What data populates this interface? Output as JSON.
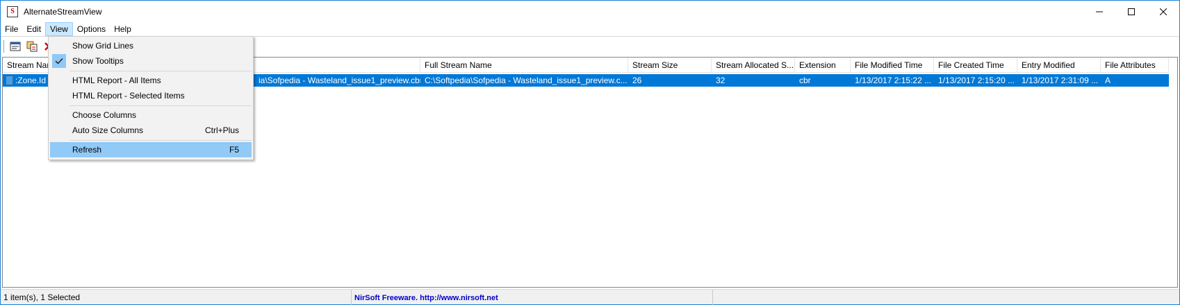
{
  "window": {
    "title": "AlternateStreamView",
    "app_icon_glyph": "S"
  },
  "menubar": {
    "items": [
      "File",
      "Edit",
      "View",
      "Options",
      "Help"
    ],
    "active": "View"
  },
  "list": {
    "columns": [
      "Stream Name",
      "",
      "Full Stream Name",
      "Stream Size",
      "Stream Allocated S...",
      "Extension",
      "File Modified Time",
      "File Created Time",
      "Entry Modified",
      "File Attributes"
    ],
    "rows": [
      {
        "cells": [
          ":Zone.Id",
          "ia\\Sofpedia - Wasteland_issue1_preview.cbr",
          "C:\\Softpedia\\Sofpedia - Wasteland_issue1_preview.c...",
          "26",
          "32",
          "cbr",
          "1/13/2017 2:15:22 ...",
          "1/13/2017 2:15:20 ...",
          "1/13/2017 2:31:09 ...",
          "A"
        ],
        "selected": true
      }
    ]
  },
  "view_menu": {
    "items": [
      {
        "label": "Show Grid Lines",
        "shortcut": "",
        "checked": false
      },
      {
        "label": "Show Tooltips",
        "shortcut": "",
        "checked": true
      },
      {
        "label": "HTML Report - All Items",
        "shortcut": "",
        "checked": false
      },
      {
        "label": "HTML Report - Selected Items",
        "shortcut": "",
        "checked": false
      },
      {
        "label": "Choose Columns",
        "shortcut": "",
        "checked": false
      },
      {
        "label": "Auto Size Columns",
        "shortcut": "Ctrl+Plus",
        "checked": false
      },
      {
        "label": "Refresh",
        "shortcut": "F5",
        "checked": false,
        "highlighted": true
      }
    ]
  },
  "statusbar": {
    "count": "1 item(s), 1 Selected",
    "credit": "NirSoft Freeware.  http://www.nirsoft.net"
  },
  "colors": {
    "selection": "#0078d7",
    "menu_highlight": "#91c9f7",
    "window_border": "#1883d7"
  }
}
